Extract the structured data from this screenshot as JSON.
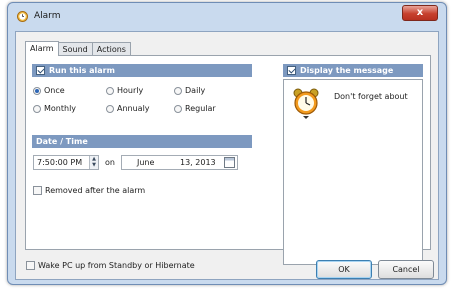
{
  "window": {
    "title": "Alarm",
    "app_icon": "alarm-clock-icon",
    "close_label": "x"
  },
  "tabs": [
    {
      "label": "Alarm",
      "active": true
    },
    {
      "label": "Sound",
      "active": false
    },
    {
      "label": "Actions",
      "active": false
    }
  ],
  "run_alarm": {
    "header": "Run this alarm",
    "checked": true,
    "options": [
      {
        "label": "Once",
        "checked": true
      },
      {
        "label": "Hourly",
        "checked": false
      },
      {
        "label": "Daily",
        "checked": false
      },
      {
        "label": "Monthly",
        "checked": false
      },
      {
        "label": "Annualy",
        "checked": false
      },
      {
        "label": "Regular",
        "checked": false
      }
    ]
  },
  "date_time": {
    "header": "Date / Time",
    "time": "7:50:00 PM",
    "on_label": "on",
    "date_month": "June",
    "date_day": "13, 2013"
  },
  "removed_after": {
    "label": "Removed after the alarm",
    "checked": false
  },
  "message": {
    "header": "Display the message",
    "checked": true,
    "text": "Don't forget about",
    "icon": "alarm-clock-icon"
  },
  "wake_pc": {
    "label": "Wake PC up from Standby or Hibernate",
    "checked": false
  },
  "buttons": {
    "ok": "OK",
    "cancel": "Cancel"
  },
  "colors": {
    "group_header": "#7d99c0",
    "window_frame": "#c9daee",
    "close_button": "#c7402e"
  }
}
